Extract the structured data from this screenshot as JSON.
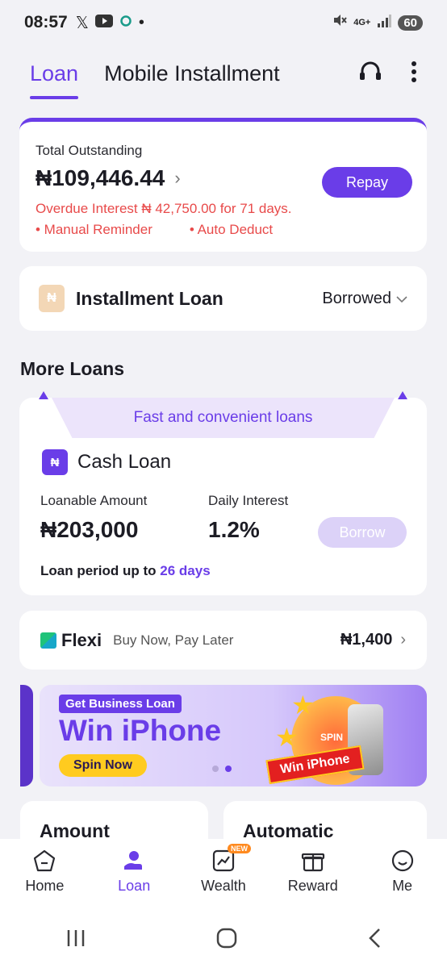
{
  "status_bar": {
    "time": "08:57",
    "battery": "60",
    "network": "4G+"
  },
  "header": {
    "tabs": [
      {
        "label": "Loan",
        "active": true
      },
      {
        "label": "Mobile Installment",
        "active": false
      }
    ],
    "support_icon": "headset-icon",
    "more_icon": "more-vertical-icon"
  },
  "outstanding": {
    "label": "Total Outstanding",
    "amount": "₦109,446.44",
    "repay_label": "Repay",
    "overdue_text": "Overdue Interest ₦ 42,750.00 for 71 days.",
    "reminder_1": "• Manual Reminder",
    "reminder_2": "• Auto Deduct"
  },
  "installment": {
    "icon_letter": "₦",
    "title": "Installment Loan",
    "status": "Borrowed"
  },
  "more_loans": {
    "title": "More Loans",
    "banner": "Fast and convenient loans",
    "cash_loan": {
      "title": "Cash Loan",
      "amount_label": "Loanable Amount",
      "amount_value": "₦203,000",
      "interest_label": "Daily Interest",
      "interest_value": "1.2%",
      "borrow_label": "Borrow",
      "period_prefix": "Loan period up to",
      "period_days": "26 days"
    }
  },
  "flexi": {
    "brand": "Flexi",
    "tagline": "Buy Now, Pay Later",
    "amount": "₦1,400"
  },
  "promo": {
    "tag": "Get Business Loan",
    "headline": "Win iPhone",
    "cta": "Spin Now",
    "ribbon": "Win iPhone",
    "wheel_text": "SPIN"
  },
  "peek_cards": {
    "left": "Amount",
    "right": "Automatic"
  },
  "bottom_nav": {
    "items": [
      {
        "label": "Home",
        "icon": "home-icon"
      },
      {
        "label": "Loan",
        "icon": "loan-icon"
      },
      {
        "label": "Wealth",
        "icon": "wealth-icon",
        "badge": "NEW"
      },
      {
        "label": "Reward",
        "icon": "gift-icon"
      },
      {
        "label": "Me",
        "icon": "smile-icon"
      }
    ]
  },
  "colors": {
    "accent": "#6a3de8",
    "danger": "#e84a4a",
    "background": "#f2f2f6"
  }
}
